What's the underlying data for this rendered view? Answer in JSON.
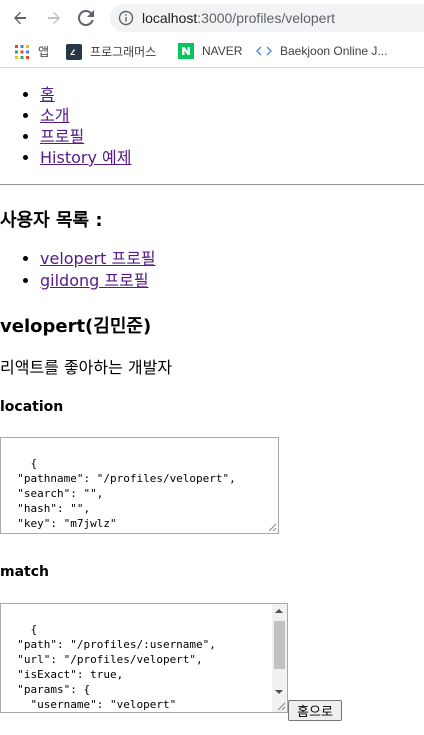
{
  "browser": {
    "url_host": "localhost",
    "url_path": ":3000/profiles/velopert",
    "bookmarks": [
      {
        "label": "앱",
        "icon": "apps-grid-icon"
      },
      {
        "label": "프로그래머스",
        "icon": "programmers-icon"
      },
      {
        "label": "NAVER",
        "icon": "naver-icon"
      },
      {
        "label": "Baekjoon Online J...",
        "icon": "code-brackets-icon"
      }
    ]
  },
  "menu": {
    "items": [
      "홈",
      "소개",
      "프로필",
      "History 예제"
    ]
  },
  "users": {
    "title": "사용자 목록 :",
    "links": [
      "velopert 프로필",
      "gildong 프로필"
    ]
  },
  "profile": {
    "name": "velopert(김민준)",
    "description": "리액트를 좋아하는 개발자"
  },
  "location": {
    "label": "location",
    "json": "{\n  \"pathname\": \"/profiles/velopert\",\n  \"search\": \"\",\n  \"hash\": \"\",\n  \"key\": \"m7jwlz\"\n}"
  },
  "match": {
    "label": "match",
    "json": "{\n  \"path\": \"/profiles/:username\",\n  \"url\": \"/profiles/velopert\",\n  \"isExact\": true,\n  \"params\": {\n    \"username\": \"velopert\"\n  }"
  },
  "home_button": {
    "label": "홈으로"
  },
  "colors": {
    "link_visited": "#551a8b",
    "naver_green": "#03c75a"
  }
}
